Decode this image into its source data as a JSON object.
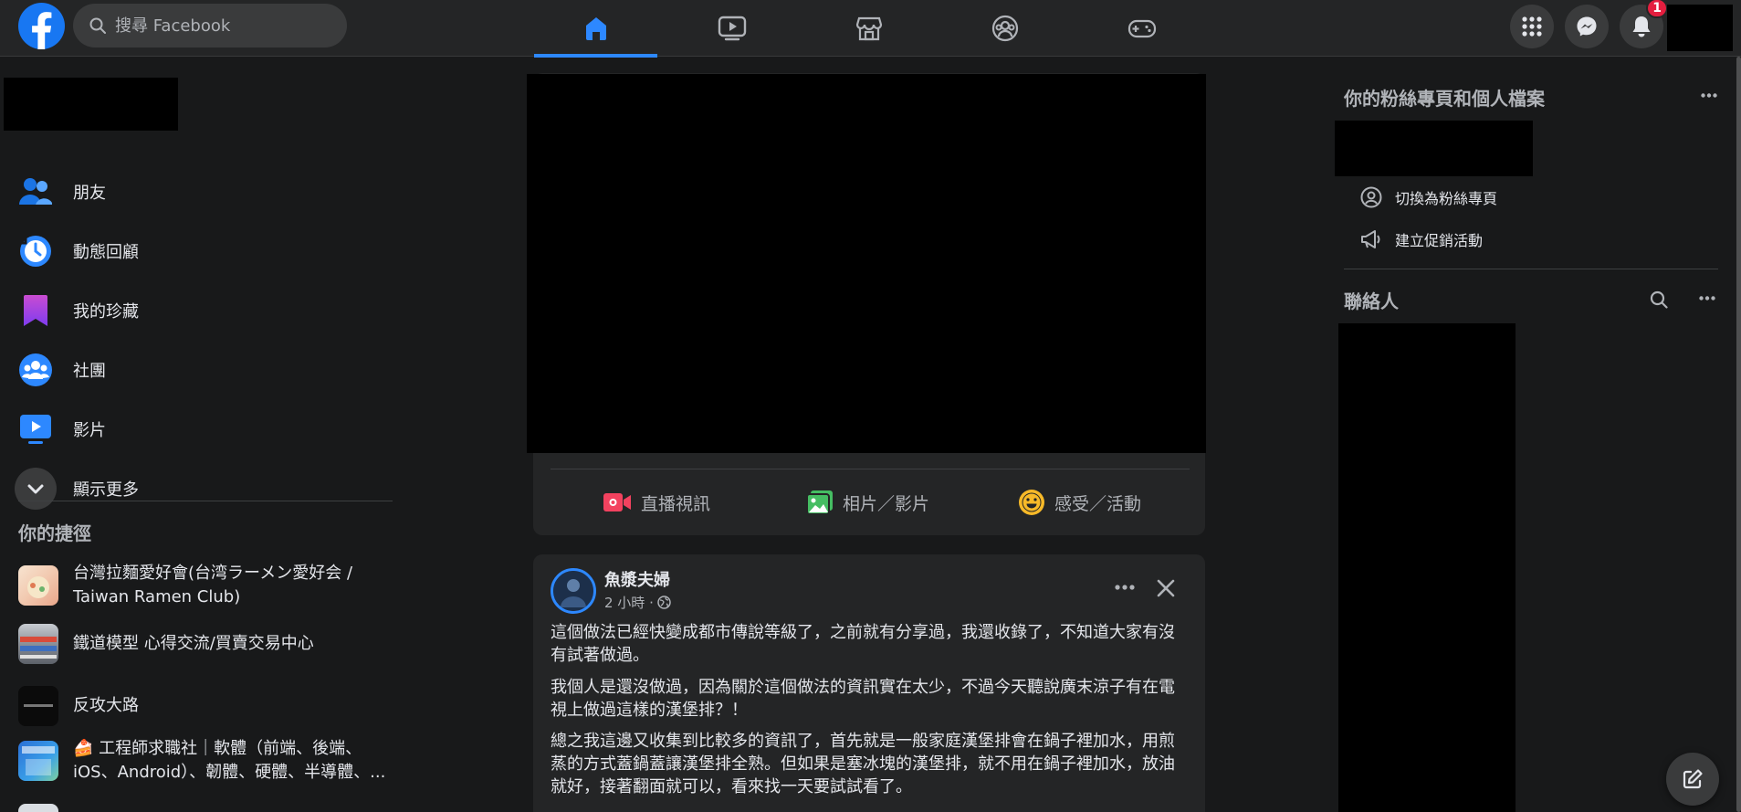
{
  "header": {
    "search_placeholder": "搜尋 Facebook",
    "notifications_badge": "1"
  },
  "sidebar": {
    "items": [
      {
        "label": "朋友",
        "icon": "friends-icon"
      },
      {
        "label": "動態回顧",
        "icon": "memories-icon"
      },
      {
        "label": "我的珍藏",
        "icon": "saved-icon"
      },
      {
        "label": "社團",
        "icon": "groups-icon"
      },
      {
        "label": "影片",
        "icon": "watch-icon"
      },
      {
        "label": "顯示更多",
        "icon": "chevron-down-icon"
      }
    ],
    "shortcuts_title": "你的捷徑",
    "shortcuts": [
      {
        "label": "台灣拉麵愛好會(台湾ラーメン愛好会 / Taiwan Ramen Club)"
      },
      {
        "label": "鐵道模型 心得交流/買賣交易中心"
      },
      {
        "label": "反攻大路"
      },
      {
        "label": "🍰 工程師求職社｜軟體（前端、後端、iOS、Android）、韌體、硬體、半導體、..."
      }
    ]
  },
  "composer": {
    "actions": [
      {
        "label": "直播視訊",
        "color": "#f3425f"
      },
      {
        "label": "相片／影片",
        "color": "#45bd62"
      },
      {
        "label": "感受／活動",
        "color": "#f7b928"
      }
    ]
  },
  "post": {
    "author": "魚漿夫婦",
    "time": "2 小時 ·",
    "paragraphs": [
      "這個做法已經快變成都市傳說等級了，之前就有分享過，我還收錄了，不知道大家有沒有試著做過。",
      "我個人是還沒做過，因為關於這個做法的資訊實在太少，不過今天聽說廣末涼子有在電視上做過這樣的漢堡排？！",
      "總之我這邊又收集到比較多的資訊了，首先就是一般家庭漢堡排會在鍋子裡加水，用煎蒸的方式蓋鍋蓋讓漢堡排全熟。但如果是塞冰塊的漢堡排，就不用在鍋子裡加水，放油就好，接著翻面就可以，看來找一天要試試看了。"
    ]
  },
  "right": {
    "pages_title": "你的粉絲專頁和個人檔案",
    "switch_label": "切換為粉絲專頁",
    "promo_label": "建立促銷活動",
    "contacts_title": "聯絡人"
  },
  "colors": {
    "accent": "#2d88ff",
    "brand": "#1877f2",
    "badge": "#e41e3f"
  }
}
